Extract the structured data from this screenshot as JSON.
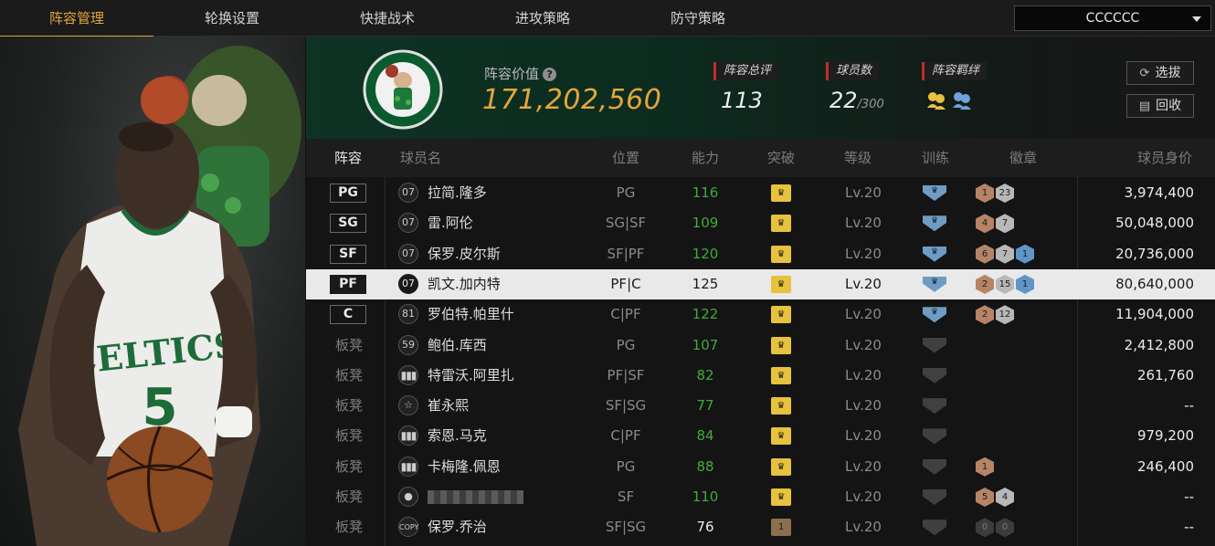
{
  "nav": {
    "tabs": [
      "阵容管理",
      "轮换设置",
      "快捷战术",
      "进攻策略",
      "防守策略"
    ],
    "active_tab": "阵容管理",
    "team_select": "CCCCCC"
  },
  "header": {
    "value_label": "阵容价值",
    "value": "171,202,560",
    "rating_label": "阵容总评",
    "rating": "113",
    "players_label": "球员数",
    "players_count": "22",
    "players_max": "/300",
    "bond_label": "阵容羁绊",
    "pick_button": "选拔",
    "recycle_button": "回收"
  },
  "table": {
    "headers": [
      "阵容",
      "球员名",
      "位置",
      "能力",
      "突破",
      "等级",
      "训练",
      "徽章",
      "球员身价"
    ],
    "bench_label": "板凳",
    "rows": [
      {
        "slot": "PG",
        "icon": "07",
        "name": "拉简.隆多",
        "pos": "PG",
        "ability": "116",
        "ability_style": "green",
        "break": "crown",
        "break_color": "gold",
        "level": "Lv.20",
        "train": "on",
        "badges": [
          {
            "c": "bronze",
            "n": "1"
          },
          {
            "c": "silver",
            "n": "23"
          }
        ],
        "price": "3,974,400"
      },
      {
        "slot": "SG",
        "icon": "07",
        "name": "雷.阿伦",
        "pos": "SG|SF",
        "ability": "109",
        "ability_style": "green",
        "break": "crown",
        "break_color": "gold",
        "level": "Lv.20",
        "train": "on",
        "badges": [
          {
            "c": "bronze",
            "n": "4"
          },
          {
            "c": "silver",
            "n": "7"
          }
        ],
        "price": "50,048,000"
      },
      {
        "slot": "SF",
        "icon": "07",
        "name": "保罗.皮尔斯",
        "pos": "SF|PF",
        "ability": "120",
        "ability_style": "green",
        "break": "crown",
        "break_color": "gold",
        "level": "Lv.20",
        "train": "on",
        "badges": [
          {
            "c": "bronze",
            "n": "6"
          },
          {
            "c": "silver",
            "n": "7"
          },
          {
            "c": "blue",
            "n": "1"
          }
        ],
        "price": "20,736,000"
      },
      {
        "slot": "PF",
        "icon": "07",
        "name": "凯文.加内特",
        "pos": "PF|C",
        "ability": "125",
        "ability_style": "white",
        "break": "crown",
        "break_color": "gold",
        "level": "Lv.20",
        "train": "on",
        "badges": [
          {
            "c": "bronze",
            "n": "2"
          },
          {
            "c": "silver",
            "n": "15"
          },
          {
            "c": "blue",
            "n": "1"
          }
        ],
        "price": "80,640,000",
        "selected": true
      },
      {
        "slot": "C",
        "icon": "81",
        "name": "罗伯特.帕里什",
        "pos": "C|PF",
        "ability": "122",
        "ability_style": "green",
        "break": "crown",
        "break_color": "gold",
        "level": "Lv.20",
        "train": "on",
        "badges": [
          {
            "c": "bronze",
            "n": "2"
          },
          {
            "c": "silver",
            "n": "12"
          }
        ],
        "price": "11,904,000"
      },
      {
        "slot": "",
        "icon": "59",
        "name": "鲍伯.库西",
        "pos": "PG",
        "ability": "107",
        "ability_style": "green",
        "break": "crown",
        "break_color": "gold",
        "level": "Lv.20",
        "train": "off",
        "badges": [],
        "price": "2,412,800"
      },
      {
        "slot": "",
        "icon": "bars",
        "name": "特雷沃.阿里扎",
        "pos": "PF|SF",
        "ability": "82",
        "ability_style": "green",
        "break": "crown",
        "break_color": "gold",
        "level": "Lv.20",
        "train": "off",
        "badges": [],
        "price": "261,760"
      },
      {
        "slot": "",
        "icon": "star",
        "name": "崔永熙",
        "pos": "SF|SG",
        "ability": "77",
        "ability_style": "green",
        "break": "crown",
        "break_color": "gold",
        "level": "Lv.20",
        "train": "off",
        "badges": [],
        "price": "--"
      },
      {
        "slot": "",
        "icon": "bars",
        "name": "索恩.马克",
        "pos": "C|PF",
        "ability": "84",
        "ability_style": "green",
        "break": "crown",
        "break_color": "gold",
        "level": "Lv.20",
        "train": "off",
        "badges": [],
        "price": "979,200"
      },
      {
        "slot": "",
        "icon": "bars",
        "name": "卡梅隆.佩恩",
        "pos": "PG",
        "ability": "88",
        "ability_style": "green",
        "break": "crown",
        "break_color": "gold",
        "level": "Lv.20",
        "train": "off",
        "badges": [
          {
            "c": "bronze",
            "n": "1"
          }
        ],
        "price": "246,400"
      },
      {
        "slot": "",
        "icon": "person",
        "name": "",
        "pos": "SF",
        "ability": "110",
        "ability_style": "green",
        "break": "crown",
        "break_color": "gold",
        "level": "Lv.20",
        "train": "off",
        "badges": [
          {
            "c": "bronze",
            "n": "5"
          },
          {
            "c": "silver",
            "n": "4"
          }
        ],
        "price": "--"
      },
      {
        "slot": "",
        "icon": "COPY",
        "name": "保罗.乔治",
        "pos": "SF|SG",
        "ability": "76",
        "ability_style": "white",
        "break": "1",
        "break_color": "brown",
        "level": "Lv.20",
        "train": "off",
        "badges": [
          {
            "c": "dark",
            "n": "0"
          },
          {
            "c": "dark",
            "n": "0"
          }
        ],
        "price": "--"
      }
    ]
  },
  "colors": {
    "accent": "#e3a63a",
    "ability_green": "#3eab38",
    "selected_row": "#e9e9e9",
    "banner_green": "#0d3324"
  }
}
